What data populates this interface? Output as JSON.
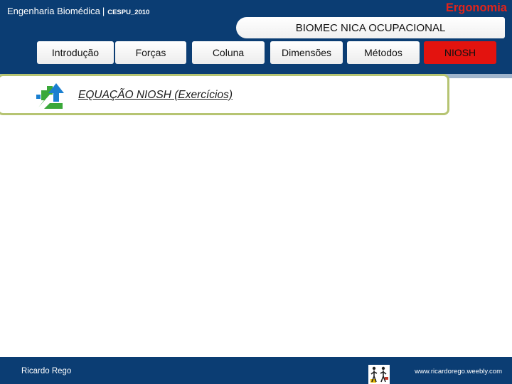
{
  "header": {
    "course": "Engenharia Biomédica",
    "separator": "|",
    "year_tag": "CESPU_2010",
    "brand": "Ergonomia",
    "slide_title": "BIOMEC NICA OCUPACIONAL"
  },
  "tabs": [
    {
      "label": "Introdução",
      "active": false
    },
    {
      "label": "Forças",
      "active": false
    },
    {
      "label": "Coluna",
      "active": false
    },
    {
      "label": "Dimensões",
      "active": false
    },
    {
      "label": "Métodos",
      "active": false
    },
    {
      "label": "NIOSH",
      "active": true
    }
  ],
  "content": {
    "link_text": "EQUAÇÃO NIOSH (Exercícios)",
    "icon": "navigation-arrows-icon"
  },
  "footer": {
    "author": "Ricardo Rego",
    "website": "www.ricardorego.weebly.com",
    "logo": "people-figures-icon"
  },
  "colors": {
    "header_blue": "#0b3d73",
    "brand_red": "#e2231a",
    "active_tab_red": "#e3130f",
    "box_border_olive": "#b6c472",
    "arrow_blue": "#1a7fd0",
    "arrow_green": "#3aa83a"
  }
}
